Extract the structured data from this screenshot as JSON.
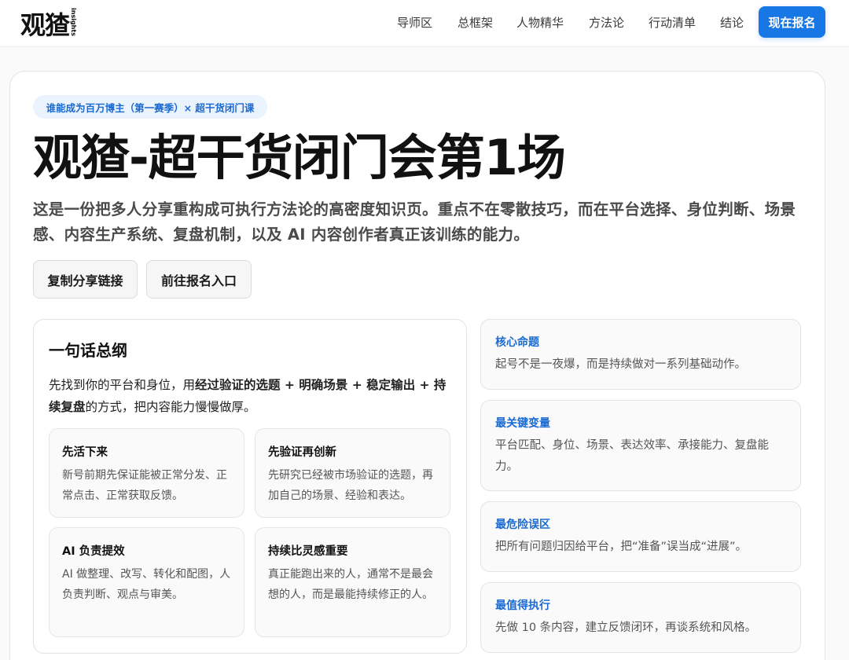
{
  "header": {
    "logo_text": "观猹",
    "logo_sub": "insights",
    "nav": [
      "导师区",
      "总框架",
      "人物精华",
      "方法论",
      "行动清单",
      "结论"
    ],
    "cta_label": "现在报名"
  },
  "hero": {
    "tag": "谁能成为百万博主（第一赛季）× 超干货闭门课",
    "title": "观猹-超干货闭门会第1场",
    "subtitle": "这是一份把多人分享重构成可执行方法论的高密度知识页。重点不在零散技巧，而在平台选择、身位判断、场景感、内容生产系统、复盘机制，以及 AI 内容创作者真正该训练的能力。",
    "buttons": [
      "复制分享链接",
      "前往报名入口"
    ]
  },
  "summary": {
    "title": "一句话总纲",
    "text_parts": [
      {
        "text": "先找到你的平台和身位，用",
        "bold": false
      },
      {
        "text": "经过验证的选题 + 明确场景 + 稳定输出 + 持续复盘",
        "bold": true
      },
      {
        "text": "的方式，把内容能力慢慢做厚。",
        "bold": false
      }
    ],
    "cards": [
      {
        "title": "先活下来",
        "body": "新号前期先保证能被正常分发、正常点击、正常获取反馈。"
      },
      {
        "title": "先验证再创新",
        "body": "先研究已经被市场验证的选题，再加自己的场景、经验和表达。"
      },
      {
        "title": "AI 负责提效",
        "body": "AI 做整理、改写、转化和配图，人负责判断、观点与审美。"
      },
      {
        "title": "持续比灵感重要",
        "body": "真正能跑出来的人，通常不是最会想的人，而是最能持续修正的人。"
      }
    ]
  },
  "info_cards": [
    {
      "label": "核心命题",
      "body": "起号不是一夜爆，而是持续做对一系列基础动作。"
    },
    {
      "label": "最关键变量",
      "body": "平台匹配、身位、场景、表达效率、承接能力、复盘能力。"
    },
    {
      "label": "最危险误区",
      "body": "把所有问题归因给平台，把“准备”误当成“进展”。"
    },
    {
      "label": "最值得执行",
      "body": "先做 10 条内容，建立反馈闭环，再谈系统和风格。"
    }
  ],
  "colors": {
    "accent": "#1677e5",
    "tag_bg": "#eaf3fe",
    "tag_text": "#1a6ad1"
  }
}
